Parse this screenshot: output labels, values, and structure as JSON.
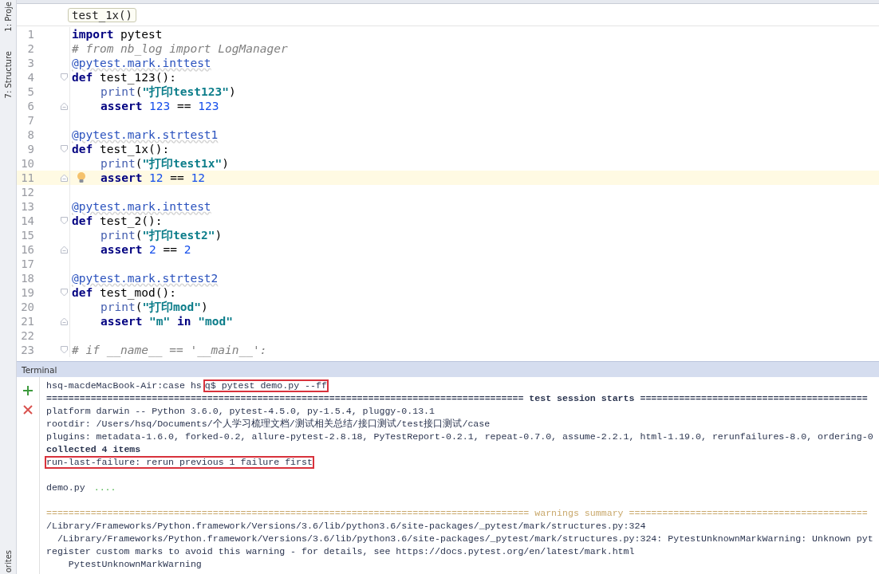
{
  "side_tabs": {
    "top": [
      {
        "label": "1: Proje"
      },
      {
        "label": "7: Structure"
      }
    ],
    "bottom": [
      {
        "label": "orites"
      }
    ]
  },
  "breadcrumb": "test_1x()",
  "code_lines": [
    {
      "number": "1",
      "indented": false,
      "current": false,
      "fold_start": false,
      "fold_end": false,
      "tokens": [
        {
          "text": "import",
          "kind": "kw"
        },
        {
          "text": " pytest",
          "kind": "plain"
        }
      ]
    },
    {
      "number": "2",
      "indented": false,
      "current": false,
      "fold_start": false,
      "fold_end": false,
      "tokens": [
        {
          "text": "# from nb_log import LogManager",
          "kind": "comment"
        }
      ]
    },
    {
      "number": "3",
      "indented": false,
      "current": false,
      "fold_start": false,
      "fold_end": false,
      "tokens": [
        {
          "text": "@pytest.mark.inttest",
          "kind": "deco"
        }
      ]
    },
    {
      "number": "4",
      "indented": false,
      "current": false,
      "fold_start": true,
      "fold_end": false,
      "tokens": [
        {
          "text": "def",
          "kind": "kw"
        },
        {
          "text": " test_123():",
          "kind": "plain"
        }
      ]
    },
    {
      "number": "5",
      "indented": true,
      "current": false,
      "fold_start": false,
      "fold_end": false,
      "tokens": [
        {
          "text": "print",
          "kind": "builtin"
        },
        {
          "text": "(",
          "kind": "plain"
        },
        {
          "text": "\"打印test123\"",
          "kind": "str"
        },
        {
          "text": ")",
          "kind": "plain"
        }
      ]
    },
    {
      "number": "6",
      "indented": true,
      "current": false,
      "fold_start": false,
      "fold_end": true,
      "tokens": [
        {
          "text": "assert",
          "kind": "kw"
        },
        {
          "text": " 123",
          "kind": "num"
        },
        {
          "text": " == ",
          "kind": "plain"
        },
        {
          "text": "123",
          "kind": "num"
        }
      ]
    },
    {
      "number": "7",
      "indented": false,
      "current": false,
      "fold_start": false,
      "fold_end": false
    },
    {
      "number": "8",
      "indented": false,
      "current": false,
      "fold_start": false,
      "fold_end": false,
      "tokens": [
        {
          "text": "@pytest.mark.strtest1",
          "kind": "deco"
        }
      ]
    },
    {
      "number": "9",
      "indented": false,
      "current": false,
      "fold_start": true,
      "fold_end": false,
      "tokens": [
        {
          "text": "def",
          "kind": "kw"
        },
        {
          "text": " test_1x():",
          "kind": "plain"
        }
      ]
    },
    {
      "number": "10",
      "indented": true,
      "current": false,
      "fold_start": false,
      "fold_end": false,
      "tokens": [
        {
          "text": "print",
          "kind": "builtin"
        },
        {
          "text": "(",
          "kind": "plain"
        },
        {
          "text": "\"打印test1x\"",
          "kind": "str"
        },
        {
          "text": ")",
          "kind": "plain"
        }
      ]
    },
    {
      "number": "11",
      "indented": true,
      "current": true,
      "fold_start": false,
      "fold_end": true,
      "tokens": [
        {
          "text": "assert",
          "kind": "kw"
        },
        {
          "text": " 12",
          "kind": "num"
        },
        {
          "text": " == ",
          "kind": "plain"
        },
        {
          "text": "12",
          "kind": "num"
        }
      ]
    },
    {
      "number": "12",
      "indented": false,
      "current": false,
      "fold_start": false,
      "fold_end": false
    },
    {
      "number": "13",
      "indented": false,
      "current": false,
      "fold_start": false,
      "fold_end": false,
      "tokens": [
        {
          "text": "@pytest.mark.inttest",
          "kind": "deco"
        }
      ]
    },
    {
      "number": "14",
      "indented": false,
      "current": false,
      "fold_start": true,
      "fold_end": false,
      "tokens": [
        {
          "text": "def",
          "kind": "kw"
        },
        {
          "text": " test_2():",
          "kind": "plain"
        }
      ]
    },
    {
      "number": "15",
      "indented": true,
      "current": false,
      "fold_start": false,
      "fold_end": false,
      "tokens": [
        {
          "text": "print",
          "kind": "builtin"
        },
        {
          "text": "(",
          "kind": "plain"
        },
        {
          "text": "\"打印test2\"",
          "kind": "str"
        },
        {
          "text": ")",
          "kind": "plain"
        }
      ]
    },
    {
      "number": "16",
      "indented": true,
      "current": false,
      "fold_start": false,
      "fold_end": true,
      "tokens": [
        {
          "text": "assert",
          "kind": "kw"
        },
        {
          "text": " 2",
          "kind": "num"
        },
        {
          "text": " == ",
          "kind": "plain"
        },
        {
          "text": "2",
          "kind": "num"
        }
      ]
    },
    {
      "number": "17",
      "indented": false,
      "current": false,
      "fold_start": false,
      "fold_end": false
    },
    {
      "number": "18",
      "indented": false,
      "current": false,
      "fold_start": false,
      "fold_end": false,
      "tokens": [
        {
          "text": "@pytest.mark.strtest2",
          "kind": "deco"
        }
      ]
    },
    {
      "number": "19",
      "indented": false,
      "current": false,
      "fold_start": true,
      "fold_end": false,
      "tokens": [
        {
          "text": "def",
          "kind": "kw"
        },
        {
          "text": " test_mod():",
          "kind": "plain"
        }
      ]
    },
    {
      "number": "20",
      "indented": true,
      "current": false,
      "fold_start": false,
      "fold_end": false,
      "tokens": [
        {
          "text": "print",
          "kind": "builtin"
        },
        {
          "text": "(",
          "kind": "plain"
        },
        {
          "text": "\"打印mod\"",
          "kind": "str"
        },
        {
          "text": ")",
          "kind": "plain"
        }
      ]
    },
    {
      "number": "21",
      "indented": true,
      "current": false,
      "fold_start": false,
      "fold_end": true,
      "tokens": [
        {
          "text": "assert",
          "kind": "kw"
        },
        {
          "text": " \"m\"",
          "kind": "str"
        },
        {
          "text": " in",
          "kind": "kw"
        },
        {
          "text": " \"mod\"",
          "kind": "str"
        }
      ]
    },
    {
      "number": "22",
      "indented": false,
      "current": false,
      "fold_start": false,
      "fold_end": false
    },
    {
      "number": "23",
      "indented": false,
      "current": false,
      "fold_start": true,
      "fold_end": false,
      "tokens": [
        {
          "text": "# if __name__ == '__main__':",
          "kind": "comment"
        }
      ]
    }
  ],
  "terminal": {
    "title": "Terminal",
    "lines": [
      {
        "blank_before": false,
        "parts": [
          {
            "text": "hsq-macdeMacBook-Air:case hs",
            "kind": "plain",
            "highlighted": false
          },
          {
            "text": "q$ pytest demo.py --ff",
            "kind": "plain",
            "highlighted": true
          }
        ]
      },
      {
        "blank_before": false,
        "parts": [
          {
            "text": "====================================================================================== test session starts =========================================",
            "kind": "bold",
            "highlighted": false
          }
        ]
      },
      {
        "blank_before": false,
        "parts": [
          {
            "text": "platform darwin -- Python 3.6.0, pytest-4.5.0, py-1.5.4, pluggy-0.13.1",
            "kind": "plain",
            "highlighted": false
          }
        ]
      },
      {
        "blank_before": false,
        "parts": [
          {
            "text": "rootdir: /Users/hsq/Documents/个人学习梳理文档/测试相关总结/接口测试/test接口测试/case",
            "kind": "plain",
            "highlighted": false
          }
        ]
      },
      {
        "blank_before": false,
        "parts": [
          {
            "text": "plugins: metadata-1.6.0, forked-0.2, allure-pytest-2.8.18, PyTestReport-0.2.1, repeat-0.7.0, assume-2.2.1, html-1.19.0, rerunfailures-8.0, ordering-0",
            "kind": "plain",
            "highlighted": false
          }
        ]
      },
      {
        "blank_before": false,
        "parts": [
          {
            "text": "collected 4 items",
            "kind": "bold",
            "highlighted": false
          }
        ]
      },
      {
        "blank_before": false,
        "parts": [
          {
            "text": "run-last-failure: rerun previous 1 failure first",
            "kind": "plain",
            "highlighted": true
          }
        ]
      },
      {
        "blank_before": true,
        "parts": [
          {
            "text": "demo.py ",
            "kind": "plain",
            "highlighted": false
          },
          {
            "text": "....",
            "kind": "pass",
            "highlighted": false
          }
        ]
      },
      {
        "blank_before": true,
        "parts": [
          {
            "text": "======================================================================================= warnings summary ===========================================",
            "kind": "warn",
            "highlighted": false
          }
        ]
      },
      {
        "blank_before": false,
        "parts": [
          {
            "text": "/Library/Frameworks/Python.framework/Versions/3.6/lib/python3.6/site-packages/_pytest/mark/structures.py:324",
            "kind": "plain",
            "highlighted": false
          }
        ]
      },
      {
        "blank_before": false,
        "parts": [
          {
            "text": "  /Library/Frameworks/Python.framework/Versions/3.6/lib/python3.6/site-packages/_pytest/mark/structures.py:324: PytestUnknownMarkWarning: Unknown pyt",
            "kind": "plain",
            "highlighted": false
          }
        ]
      },
      {
        "blank_before": false,
        "parts": [
          {
            "text": "register custom marks to avoid this warning - for details, see https://docs.pytest.org/en/latest/mark.html",
            "kind": "plain",
            "highlighted": false
          }
        ]
      },
      {
        "blank_before": false,
        "parts": [
          {
            "text": "    PytestUnknownMarkWarning",
            "kind": "plain",
            "highlighted": false
          }
        ]
      }
    ]
  }
}
